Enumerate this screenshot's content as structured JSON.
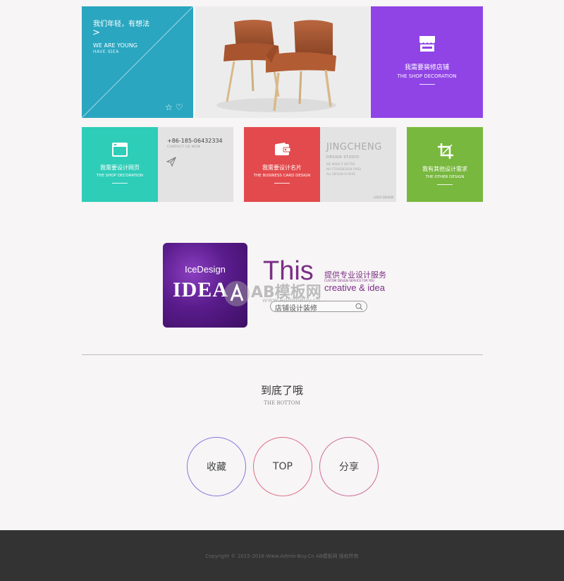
{
  "tiles": {
    "intro": {
      "title_zh": "我们年轻，有想法",
      "arrow": ">",
      "title_en": "WE ARE YOUNG",
      "sub_en": "HAVE IDEA",
      "icons": [
        "star-icon",
        "heart-icon"
      ]
    },
    "shop": {
      "title_zh": "我需要装修店铺",
      "title_en": "THE SHOP DECORATION",
      "icon": "store-icon"
    },
    "web": {
      "title_zh": "我需要设计网页",
      "title_en": "THE SHOP DECORATION",
      "icon": "browser-icon"
    },
    "contact": {
      "phone": "+86-185-06432334",
      "sub": "CONTACT US NOW",
      "icon": "send-icon"
    },
    "card": {
      "title_zh": "我需要设计名片",
      "title_en": "THE BUSINESS CARD DESIGN",
      "icon": "wallet-icon"
    },
    "jingcheng": {
      "brand": "JINGCHENG",
      "tag": "DESIGN STUDIO",
      "lines": [
        "WE MAKE IT BETTER",
        "NO STOREDESIGN FIXED",
        "ALL DESIGN IS HERE"
      ],
      "corner": "LOGO DESIGN"
    },
    "other": {
      "title_zh": "我有其他设计需求",
      "title_en": "THE OTHER DESIGN",
      "icon": "crop-icon"
    }
  },
  "banner": {
    "logo_top": "IceDesign",
    "logo_big": "IDEA",
    "headline": "This",
    "tagline_zh": "提供专业设计服务",
    "tagline_en": "CUSTOM DESIGN SERVICE FOR YOU",
    "creative": "creative & idea",
    "search_placeholder": "店铺设计装修",
    "watermark_main": "AB模板网",
    "watermark_url": "www.AdminBuy.cn"
  },
  "bottom": {
    "title_zh": "到底了哦",
    "title_en": "THE BOTTOM",
    "buttons": [
      "收藏",
      "TOP",
      "分享"
    ]
  },
  "footer": {
    "copyright": "Copyright © 2015-2016 Www.Admin-Buy.Cn AB模板网 版权所有"
  },
  "colors": {
    "teal": "#2aa6c0",
    "purple": "#9044e6",
    "mint": "#2ecdb8",
    "red": "#e34a4d",
    "green": "#78b83e",
    "footer": "#333333"
  }
}
